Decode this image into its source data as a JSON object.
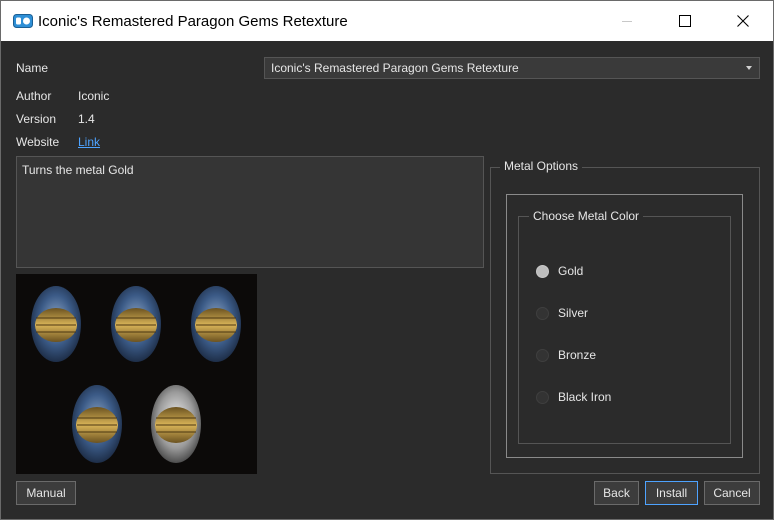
{
  "window": {
    "title": "Iconic's Remastered Paragon Gems Retexture",
    "icon": "app-logo-icon",
    "controls": [
      "minimize-icon",
      "maximize-icon",
      "close-icon"
    ]
  },
  "form": {
    "name_label": "Name",
    "name_value": "Iconic's Remastered Paragon Gems Retexture",
    "author_label": "Author",
    "author_value": "Iconic",
    "version_label": "Version",
    "version_value": "1.4",
    "website_label": "Website",
    "website_value": "Link"
  },
  "description": "Turns the metal Gold",
  "metal_options": {
    "title": "Metal Options",
    "color_group": {
      "title": "Choose Metal Color",
      "options": [
        {
          "label": "Gold",
          "checked": true
        },
        {
          "label": "Silver",
          "checked": false
        },
        {
          "label": "Bronze",
          "checked": false
        },
        {
          "label": "Black Iron",
          "checked": false
        }
      ]
    }
  },
  "buttons": {
    "manual": "Manual",
    "back": "Back",
    "install": "Install",
    "cancel": "Cancel"
  },
  "colors": {
    "background": "#2b2b2b",
    "accent": "#4ea3ff",
    "gold": "#c9a441"
  }
}
